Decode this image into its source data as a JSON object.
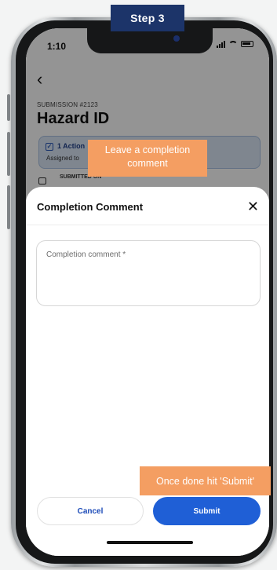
{
  "annotation": {
    "step_label": "Step 3",
    "callout_comment": "Leave a completion comment",
    "callout_submit": "Once done hit 'Submit'",
    "callout_color": "#f49e62",
    "step_color": "#1c3469"
  },
  "status_bar": {
    "time": "1:10",
    "icons": [
      "signal-icon",
      "wifi-icon",
      "battery-icon"
    ]
  },
  "background_screen": {
    "back_icon": "chevron-left-icon",
    "submission_id": "SUBMISSION #2123",
    "title": "Hazard ID",
    "action_card_label": "1 Action",
    "assigned_label": "Assigned to",
    "submitted_label": "SUBMITTED ON"
  },
  "modal": {
    "title": "Completion Comment",
    "close_icon": "close-icon",
    "comment_placeholder": "Completion comment *",
    "comment_value": "",
    "cancel_label": "Cancel",
    "submit_label": "Submit",
    "primary_color": "#1f5fd6"
  }
}
